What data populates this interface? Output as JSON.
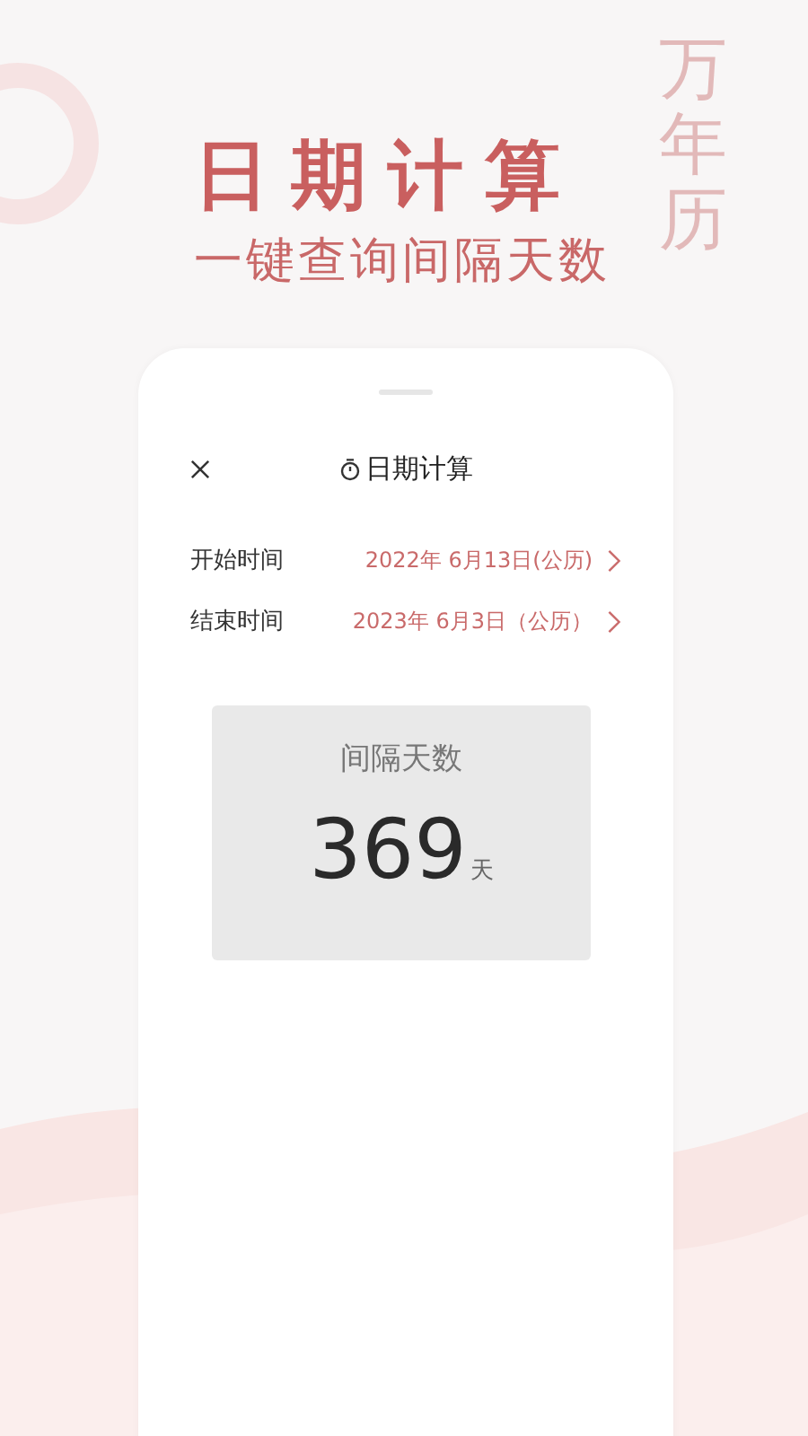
{
  "promo": {
    "side_title": "万年历",
    "title": "日期计算",
    "subtitle": "一键查询间隔天数"
  },
  "screen": {
    "title": "日期计算",
    "rows": [
      {
        "label": "开始时间",
        "value": "2022年 6月13日(公历)"
      },
      {
        "label": "结束时间",
        "value": "2023年 6月3日（公历）"
      }
    ],
    "result": {
      "label": "间隔天数",
      "value": "369",
      "unit": "天"
    }
  }
}
